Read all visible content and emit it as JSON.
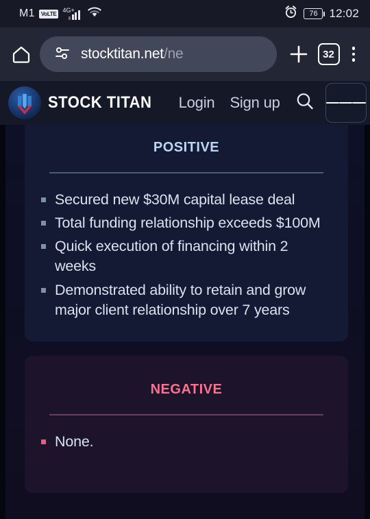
{
  "status_bar": {
    "carrier": "M1",
    "volte_badge": "VoLTE",
    "network_type": "4G+",
    "battery_percent": "76",
    "time": "12:02"
  },
  "browser": {
    "url_visible": "stocktitan.net",
    "url_dim": "/ne",
    "tab_count": "32"
  },
  "site_header": {
    "brand": "STOCK TITAN",
    "nav": [
      {
        "label": "Login"
      },
      {
        "label": "Sign up"
      }
    ]
  },
  "content": {
    "cards": [
      {
        "title": "Positive",
        "items": [
          "Secured new $30M capital lease deal",
          "Total funding relationship exceeds $100M",
          "Quick execution of financing within 2 weeks",
          "Demonstrated ability to retain and grow major client relationship over 7 years"
        ]
      },
      {
        "title": "Negative",
        "items": [
          "None."
        ]
      }
    ]
  },
  "colors": {
    "positive_accent": "#bcd6f5",
    "negative_accent": "#f8738f",
    "page_bg": "#05070f",
    "positive_card_bg": "#141a33",
    "negative_card_bg": "#1d142b"
  }
}
